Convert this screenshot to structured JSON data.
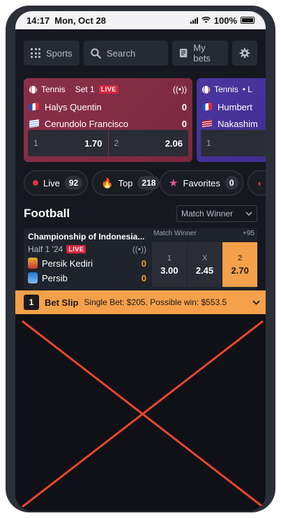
{
  "statusbar": {
    "time": "14:17",
    "date": "Mon, Oct 28",
    "battery": "100%"
  },
  "nav": {
    "sports": "Sports",
    "search": "Search",
    "my_bets": "My bets"
  },
  "live_cards": [
    {
      "sport": "Tennis",
      "period": "Set 1",
      "live": "LIVE",
      "team1": "Halys Quentin",
      "score1": "0",
      "team2": "Cerundolo Francisco",
      "score2": "0",
      "odd1_label": "1",
      "odd1_value": "1.70",
      "odd2_label": "2",
      "odd2_value": "2.06"
    },
    {
      "sport": "Tennis",
      "period": "•  L",
      "team1": "Humbert",
      "team2": "Nakashim",
      "odd1_label": "1"
    }
  ],
  "filters": [
    {
      "label": "Live",
      "count": "92"
    },
    {
      "label": "Top",
      "count": "218"
    },
    {
      "label": "Favorites",
      "count": "0"
    }
  ],
  "section": {
    "title": "Football",
    "market_select": "Match Winner"
  },
  "match": {
    "league": "Championship of Indonesia...",
    "period": "Half 1 '24",
    "live": "LIVE",
    "team1": "Persik Kediri",
    "score1": "0",
    "team2": "Persib",
    "score2": "0",
    "market": "Match Winner",
    "more": "+95",
    "odds": [
      {
        "label": "1",
        "value": "3.00"
      },
      {
        "label": "X",
        "value": "2.45"
      },
      {
        "label": "2",
        "value": "2.70"
      }
    ]
  },
  "betslip": {
    "count": "1",
    "title": "Bet Slip",
    "summary": "Single Bet: $205, Possible win: $553.5"
  },
  "colors": {
    "accent": "#f5a04a",
    "live": "#d7263d",
    "card_red": "#8a3049",
    "card_blue": "#4a36a0"
  }
}
